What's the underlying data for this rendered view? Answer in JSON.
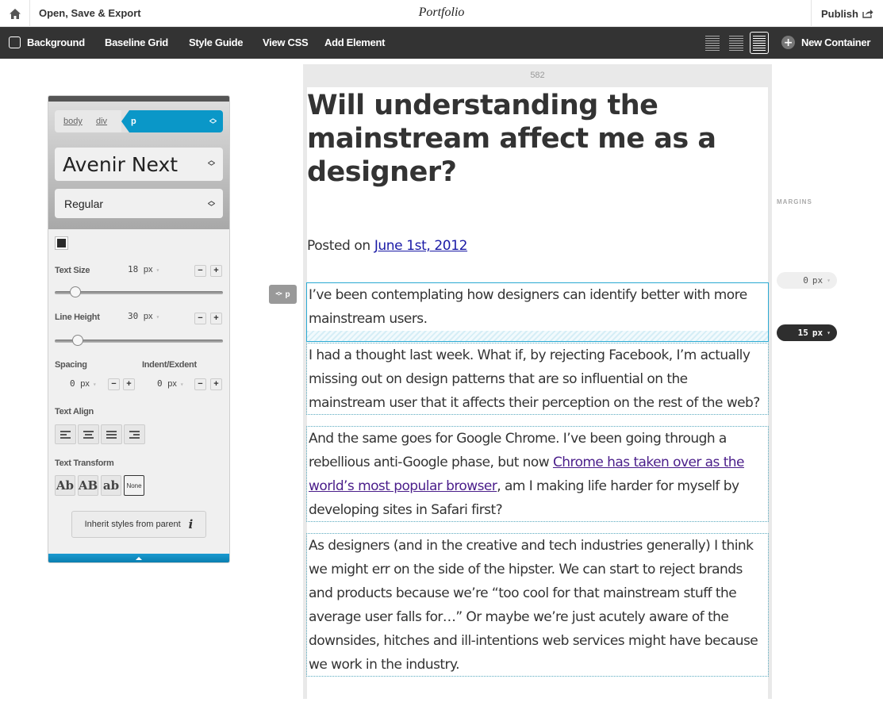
{
  "topbar": {
    "home_icon": "home-icon",
    "open_save_label": "Open, Save & Export",
    "title": "Portfolio",
    "publish_label": "Publish",
    "publish_icon": "share-icon"
  },
  "toolbar": {
    "background_label": "Background",
    "background_checked": false,
    "items": [
      "Baseline Grid",
      "Style Guide",
      "View CSS",
      "Add Element"
    ],
    "grid_density_options": [
      "narrow",
      "medium",
      "wide"
    ],
    "grid_density_selected": "wide",
    "new_container_label": "New Container"
  },
  "inspector": {
    "breadcrumb": [
      "body",
      "div",
      "p"
    ],
    "font_family": "Avenir Next",
    "font_weight": "Regular",
    "text_color": "#2a2a2a",
    "text_size": {
      "label": "Text Size",
      "value": "18",
      "unit": "px"
    },
    "line_height": {
      "label": "Line Height",
      "value": "30",
      "unit": "px"
    },
    "spacing": {
      "label": "Spacing",
      "value": "0",
      "unit": "px"
    },
    "indent": {
      "label": "Indent/Exdent",
      "value": "0",
      "unit": "px"
    },
    "text_align_label": "Text Align",
    "text_align_options": [
      "left",
      "center",
      "justify",
      "right"
    ],
    "text_transform_label": "Text Transform",
    "text_transform_options": [
      "Ab",
      "AB",
      "ab",
      "None"
    ],
    "text_transform_selected": "None",
    "inherit_label": "Inherit styles from parent",
    "minus": "−",
    "plus": "+"
  },
  "page": {
    "width_readout": "582",
    "headline": "Will understanding the mainstream affect me as a designer?",
    "posted_prefix": "Posted on ",
    "posted_date": "June 1st, 2012",
    "element_tag": "p",
    "paragraphs": [
      {
        "text": "I’ve been contemplating how designers can identify better with more mainstream users."
      },
      {
        "text": "I had a thought last week. What if, by rejecting Facebook, I’m actually missing out on design patterns that are so influential on the mainstream user that it affects their perception on the rest of the web?"
      },
      {
        "before": "And the same goes for Google Chrome. I’ve been going through a rebellious anti-Google phase, but now ",
        "link": "Chrome has taken over as the world’s most popular browser",
        "after": ", am I making life harder for myself by developing sites in Safari first?"
      },
      {
        "text": "As designers (and in the creative and tech industries generally) I think we might err on the side of the hipster. We can start to reject brands and products because we’re “too cool for that mainstream stuff the average user falls for…” Or maybe we’re just acutely aware of the downsides, hitches and ill-intentions web services might have because we work in the industry."
      }
    ]
  },
  "margins": {
    "label": "MARGINS",
    "top": {
      "value": "0",
      "unit": "px"
    },
    "bottom": {
      "value": "15",
      "unit": "px"
    }
  }
}
